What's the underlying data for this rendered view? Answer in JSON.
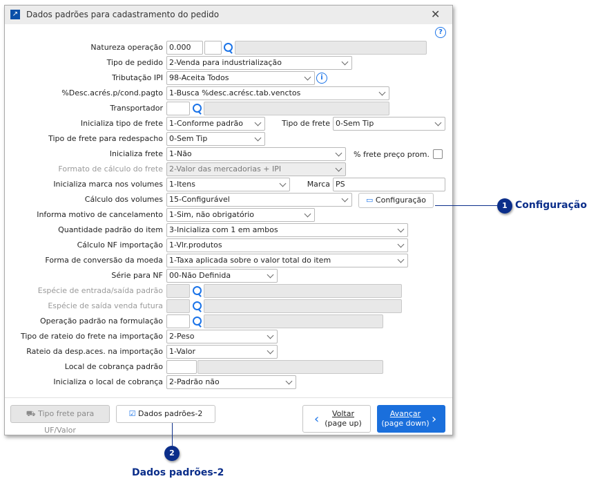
{
  "window": {
    "title": "Dados padrões para cadastramento do pedido",
    "close_icon": "close-icon",
    "help_icon": "help-icon"
  },
  "fields": {
    "natureza": {
      "label": "Natureza operação",
      "value": "0.000",
      "value2": "",
      "desc": ""
    },
    "tipo_pedido": {
      "label": "Tipo de pedido",
      "value": "2-Venda para industrialização"
    },
    "tributacao_ipi": {
      "label": "Tributação IPI",
      "value": "98-Aceita Todos"
    },
    "desc_acres": {
      "label": "%Desc.acrés.p/cond.pagto",
      "value": "1-Busca %desc.acrésc.tab.venctos"
    },
    "transportador": {
      "label": "Transportador",
      "value": "",
      "desc": ""
    },
    "inicializa_tipo_frete": {
      "label": "Inicializa tipo de frete",
      "value": "1-Conforme padrão"
    },
    "tipo_frete": {
      "label": "Tipo de frete",
      "value": "0-Sem Tip"
    },
    "tipo_frete_redespacho": {
      "label": "Tipo de frete para redespacho",
      "value": "0-Sem Tip"
    },
    "inicializa_frete": {
      "label": "Inicializa frete",
      "value": "1-Não"
    },
    "frete_preco_prom": {
      "label": "% frete preço prom.",
      "checked": false
    },
    "formato_calculo_frete": {
      "label": "Formato de cálculo do frete",
      "value": "2-Valor das mercadorias + IPI",
      "disabled": true
    },
    "inicializa_marca": {
      "label": "Inicializa marca nos volumes",
      "value": "1-Itens"
    },
    "marca": {
      "label": "Marca",
      "value": "PS"
    },
    "calculo_volumes": {
      "label": "Cálculo dos volumes",
      "value": "15-Configurável"
    },
    "configuracao_button": {
      "label": "Configuração"
    },
    "motivo_cancelamento": {
      "label": "Informa motivo de cancelamento",
      "value": "1-Sim, não obrigatório"
    },
    "quantidade_padrao": {
      "label": "Quantidade padrão do item",
      "value": "3-Inicializa com 1 em ambos"
    },
    "calculo_nf_importacao": {
      "label": "Cálculo NF importação",
      "value": "1-Vlr.produtos"
    },
    "forma_conversao_moeda": {
      "label": "Forma de conversão da moeda",
      "value": "1-Taxa aplicada sobre o valor total do item"
    },
    "serie_nf": {
      "label": "Série para NF",
      "value": "00-Não Definida"
    },
    "especie_entrada_saida": {
      "label": "Espécie de entrada/saída padrão",
      "value": "",
      "desc": "",
      "disabled": true
    },
    "especie_saida_futura": {
      "label": "Espécie de saída venda futura",
      "value": "",
      "desc": "",
      "disabled": true
    },
    "operacao_formulacao": {
      "label": "Operação padrão na formulação",
      "value": "",
      "desc": ""
    },
    "tipo_rateio_frete": {
      "label": "Tipo de rateio do frete na importação",
      "value": "2-Peso"
    },
    "rateio_desp_aces": {
      "label": "Rateio da desp.aces. na importação",
      "value": "1-Valor"
    },
    "local_cobranca": {
      "label": "Local de cobrança padrão",
      "value": "",
      "desc": ""
    },
    "inicializa_local_cobranca": {
      "label": "Inicializa o local de cobrança",
      "value": "2-Padrão não"
    }
  },
  "footer": {
    "tipo_frete_uf": "Tipo frete para UF/Valor",
    "dados_padroes_2": "Dados padrões-2",
    "voltar": "Voltar",
    "voltar_sub": "(page up)",
    "avancar": "Avançar",
    "avancar_sub": "(page down)"
  },
  "callouts": [
    {
      "number": "1",
      "text": "Configuração"
    },
    {
      "number": "2",
      "text": "Dados padrões-2"
    }
  ],
  "colors": {
    "accent": "#1a73e8",
    "callout": "#0b2e8a"
  }
}
